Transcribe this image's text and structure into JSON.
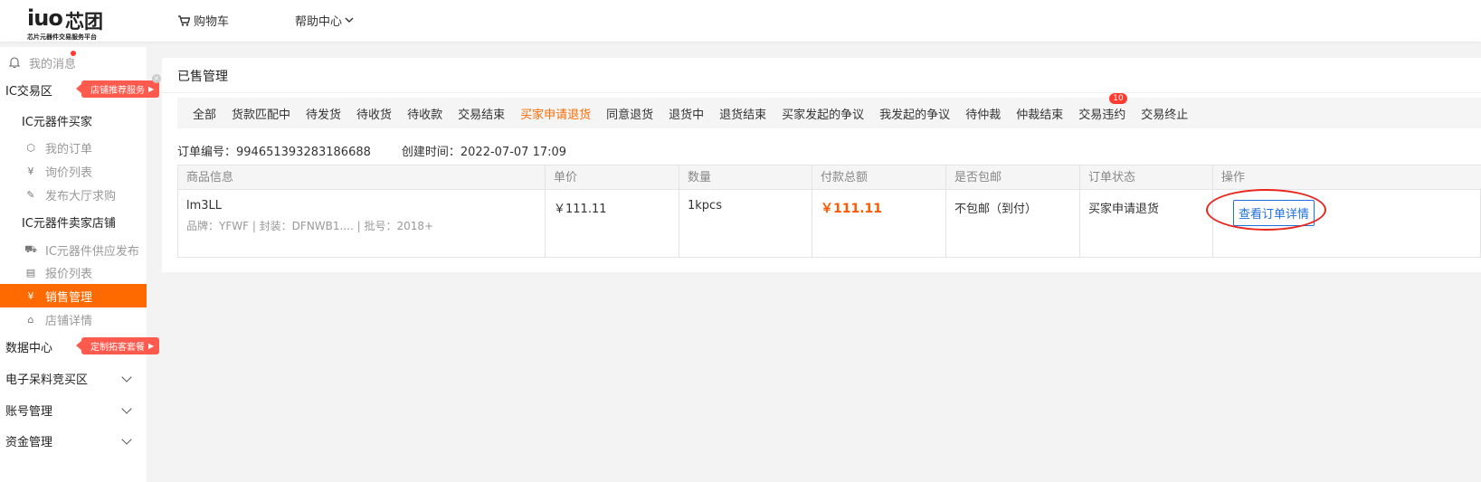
{
  "header": {
    "logo_mark": "iuo",
    "logo_text": "芯团",
    "logo_sub": "芯片元器件交易服务平台",
    "cart_label": "购物车",
    "help_label": "帮助中心"
  },
  "sidebar": {
    "messages": "我的消息",
    "ic_zone": "IC交易区",
    "promo_shop": "店铺推荐服务",
    "buyer_group": "IC元器件买家",
    "my_orders": "我的订单",
    "inquiry_list": "询价列表",
    "publish_request": "发布大厅求购",
    "seller_group": "IC元器件卖家店铺",
    "supply_publish": "IC元器件供应发布",
    "quote_list": "报价列表",
    "sales_mgmt": "销售管理",
    "shop_detail": "店铺详情",
    "data_center": "数据中心",
    "promo_custom": "定制拓客套餐",
    "auction_zone": "电子呆料竞买区",
    "account_mgmt": "账号管理",
    "fund_mgmt": "资金管理"
  },
  "main": {
    "title": "已售管理",
    "tabs": [
      {
        "label": "全部"
      },
      {
        "label": "货款匹配中"
      },
      {
        "label": "待发货"
      },
      {
        "label": "待收货"
      },
      {
        "label": "待收款"
      },
      {
        "label": "交易结束"
      },
      {
        "label": "买家申请退货"
      },
      {
        "label": "同意退货"
      },
      {
        "label": "退货中"
      },
      {
        "label": "退货结束"
      },
      {
        "label": "买家发起的争议"
      },
      {
        "label": "我发起的争议"
      },
      {
        "label": "待仲裁"
      },
      {
        "label": "仲裁结束"
      },
      {
        "label": "交易违约"
      },
      {
        "label": "交易终止"
      }
    ],
    "active_tab": 6,
    "violation_badge": "10",
    "order_no": "订单编号：994651393283186688",
    "created_time": "创建时间：2022-07-07 17:09",
    "columns": [
      "商品信息",
      "单价",
      "数量",
      "付款总额",
      "是否包邮",
      "订单状态",
      "操作"
    ],
    "row": {
      "product_name": "lm3LL",
      "product_meta": "品牌：YFWF  |  封装：DFNWB1....  |  批号：2018+",
      "unit_price": "￥111.11",
      "quantity": "1kpcs",
      "total": "￥111.11",
      "shipping": "不包邮（到付）",
      "status": "买家申请退货",
      "action_label": "查看订单详情"
    }
  },
  "colors": {
    "accent": "#ff6a00",
    "promo": "#ff5a4e",
    "link": "#1e6fd9",
    "highlight_circle": "#e8261c"
  }
}
